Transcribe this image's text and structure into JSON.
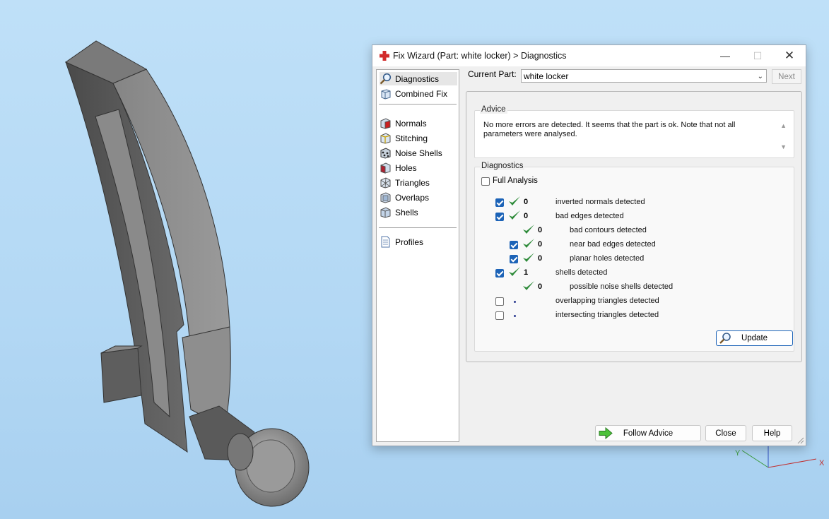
{
  "window": {
    "title": "Fix Wizard (Part: white locker) > Diagnostics",
    "min_glyph": "—",
    "max_glyph": "☐",
    "close_glyph": "✕"
  },
  "nav": {
    "items": [
      {
        "label": "Diagnostics",
        "icon": "magnifier-icon",
        "selected": true
      },
      {
        "label": "Combined Fix",
        "icon": "cube-icon"
      },
      {
        "label": "Normals",
        "icon": "normals-cube-icon"
      },
      {
        "label": "Stitching",
        "icon": "stitching-cube-icon"
      },
      {
        "label": "Noise Shells",
        "icon": "noise-shells-icon"
      },
      {
        "label": "Holes",
        "icon": "holes-cube-icon"
      },
      {
        "label": "Triangles",
        "icon": "triangles-cube-icon"
      },
      {
        "label": "Overlaps",
        "icon": "overlaps-cube-icon"
      },
      {
        "label": "Shells",
        "icon": "shells-cube-icon"
      },
      {
        "label": "Profiles",
        "icon": "document-icon"
      }
    ]
  },
  "current_part": {
    "label": "Current Part:",
    "value": "white locker",
    "next_label": "Next"
  },
  "advice": {
    "title": "Advice",
    "text": "No more errors are detected. It seems that the part is ok. Note that not all parameters were analysed."
  },
  "diagnostics": {
    "title": "Diagnostics",
    "full_analysis_label": "Full Analysis",
    "full_analysis_checked": false,
    "rows": [
      {
        "checkbox": true,
        "checked": true,
        "status": "tick",
        "count": "0",
        "label": "inverted normals detected",
        "indent": 0
      },
      {
        "checkbox": true,
        "checked": true,
        "status": "tick",
        "count": "0",
        "label": "bad edges detected",
        "indent": 0
      },
      {
        "checkbox": false,
        "checked": false,
        "status": "tick",
        "count": "0",
        "label": "bad contours detected",
        "indent": 1
      },
      {
        "checkbox": true,
        "checked": true,
        "status": "tick",
        "count": "0",
        "label": "near bad edges detected",
        "indent": 1
      },
      {
        "checkbox": true,
        "checked": true,
        "status": "tick",
        "count": "0",
        "label": "planar holes detected",
        "indent": 1
      },
      {
        "checkbox": true,
        "checked": true,
        "status": "tick",
        "count": "1",
        "label": "shells detected",
        "indent": 0
      },
      {
        "checkbox": false,
        "checked": false,
        "status": "tick",
        "count": "0",
        "label": "possible noise shells detected",
        "indent": 1
      },
      {
        "checkbox": true,
        "checked": false,
        "status": "dot",
        "count": "",
        "label": "overlapping triangles detected",
        "indent": 0
      },
      {
        "checkbox": true,
        "checked": false,
        "status": "dot",
        "count": "",
        "label": "intersecting triangles detected",
        "indent": 0
      }
    ],
    "update_label": "Update"
  },
  "buttons": {
    "follow_advice": "Follow Advice",
    "close": "Close",
    "help": "Help"
  },
  "axes": {
    "y": "Y",
    "x": "X"
  },
  "colors": {
    "accent": "#1c63b7",
    "tick_green": "#2e8b3a",
    "part_gray": "#6e6e6e"
  }
}
